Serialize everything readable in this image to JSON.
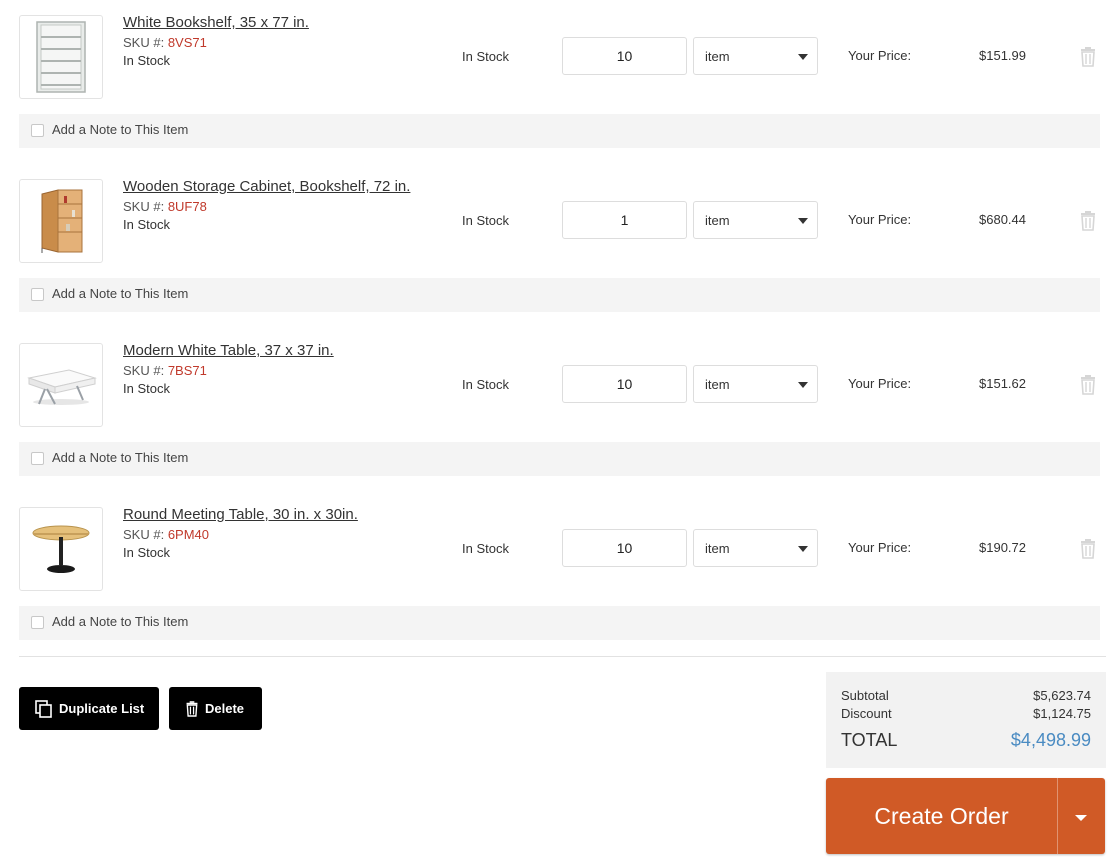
{
  "items": [
    {
      "name": "White Bookshelf, 35 x 77 in.",
      "sku_label": "SKU #:",
      "sku": "8VS71",
      "status": "In Stock",
      "stock_column": "In Stock",
      "quantity": "10",
      "unit": "item",
      "price_label": "Your Price:",
      "price": "$151.99",
      "note_label": "Add a Note to This Item",
      "icon": "white-bookshelf-image"
    },
    {
      "name": "Wooden Storage Cabinet, Bookshelf, 72 in.",
      "sku_label": "SKU #:",
      "sku": "8UF78",
      "status": "In Stock",
      "stock_column": "In Stock",
      "quantity": "1",
      "unit": "item",
      "price_label": "Your Price:",
      "price": "$680.44",
      "note_label": "Add a Note to This Item",
      "icon": "wooden-cabinet-image"
    },
    {
      "name": "Modern White Table, 37 x 37 in.",
      "sku_label": "SKU #:",
      "sku": "7BS71",
      "status": "In Stock",
      "stock_column": "In Stock",
      "quantity": "10",
      "unit": "item",
      "price_label": "Your Price:",
      "price": "$151.62",
      "note_label": "Add a Note to This Item",
      "icon": "white-table-image"
    },
    {
      "name": "Round Meeting Table, 30 in. x 30in.",
      "sku_label": "SKU #:",
      "sku": "6PM40",
      "status": "In Stock",
      "stock_column": "In Stock",
      "quantity": "10",
      "unit": "item",
      "price_label": "Your Price:",
      "price": "$190.72",
      "note_label": "Add a Note to This Item",
      "icon": "round-table-image"
    }
  ],
  "actions": {
    "duplicate_label": "Duplicate List",
    "delete_label": "Delete"
  },
  "summary": {
    "subtotal_label": "Subtotal",
    "subtotal": "$5,623.74",
    "discount_label": "Discount",
    "discount": "$1,124.75",
    "total_label": "TOTAL",
    "total": "$4,498.99"
  },
  "create_order_label": "Create Order",
  "colors": {
    "sku": "#c0392b",
    "total": "#4a8bc2",
    "create_order": "#d05a26"
  }
}
